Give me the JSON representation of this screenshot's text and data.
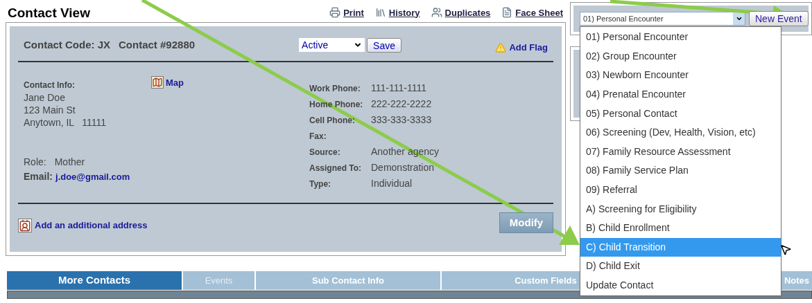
{
  "header": {
    "title": "Contact View",
    "links": [
      {
        "label": "Print"
      },
      {
        "label": "History"
      },
      {
        "label": "Duplicates"
      },
      {
        "label": "Face Sheet"
      }
    ]
  },
  "contact": {
    "code": "Contact Code: JX",
    "number": "Contact #92880",
    "status": "Active",
    "save": "Save",
    "add_flag": "Add Flag",
    "info_label": "Contact Info:",
    "map": "Map",
    "address_lines": [
      "Jane Doe",
      "123 Main St",
      "Anytown, IL   11111"
    ],
    "role_label": "Role:",
    "role": "Mother",
    "email_label": "Email:",
    "email": "j.doe@gmail.com",
    "fields": [
      {
        "label": "Work Phone:",
        "value": "111-111-1111"
      },
      {
        "label": "Home Phone:",
        "value": "222-222-2222"
      },
      {
        "label": "Cell Phone:",
        "value": "333-333-3333"
      },
      {
        "label": "Fax:"
      },
      {
        "label": "Source:",
        "value": "Another agency"
      },
      {
        "label": "Assigned To:",
        "value": "Demonstration"
      },
      {
        "label": "Type:",
        "value": "Individual"
      }
    ],
    "add_address": "Add an additional address",
    "modify": "Modify"
  },
  "events": {
    "select_value": "01) Personal Encounter",
    "new_event": "New Event",
    "options": [
      {
        "label": "01) Personal Encounter",
        "selected": false
      },
      {
        "label": "02) Group Encounter",
        "selected": false
      },
      {
        "label": "03) Newborn Encounter",
        "selected": false
      },
      {
        "label": "04) Prenatal Encounter",
        "selected": false
      },
      {
        "label": "05) Personal Contact",
        "selected": false
      },
      {
        "label": "06) Screening (Dev, Health, Vision, etc)",
        "selected": false
      },
      {
        "label": "07) Family Resource Assessment",
        "selected": false
      },
      {
        "label": "08) Family Service Plan",
        "selected": false
      },
      {
        "label": "09) Referral",
        "selected": false
      },
      {
        "label": "A) Screening for Eligibility",
        "selected": false
      },
      {
        "label": "B) Child Enrollment",
        "selected": false
      },
      {
        "label": "C) Child Transition",
        "selected": true
      },
      {
        "label": "D) Child Exit",
        "selected": false
      },
      {
        "label": "Update Contact",
        "selected": false
      }
    ]
  },
  "tabs": [
    {
      "label": "More Contacts",
      "selected": true,
      "disabled": false
    },
    {
      "label": "Events",
      "selected": false,
      "disabled": true
    },
    {
      "label": "Sub Contact Info",
      "selected": false,
      "disabled": false
    },
    {
      "label": "Custom Fields",
      "selected": false,
      "disabled": false
    },
    {
      "label": "Notes",
      "selected": false,
      "disabled": false
    }
  ]
}
